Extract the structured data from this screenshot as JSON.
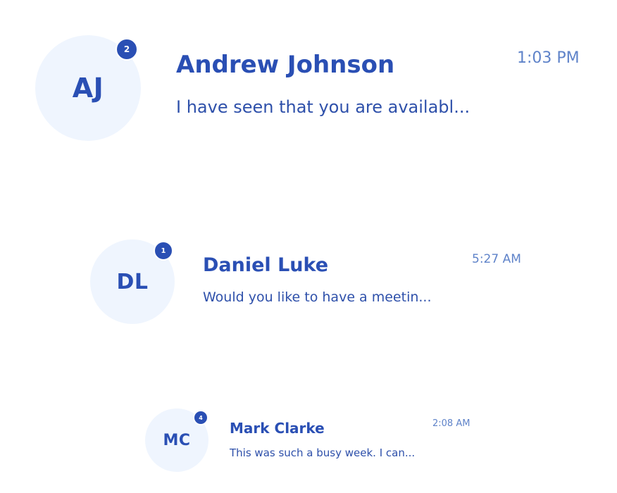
{
  "colors": {
    "accent": "#2a4fb4",
    "avatar_bg": "#eff5fe",
    "timestamp": "#5f83c9",
    "background": "#ffffff"
  },
  "conversations": [
    {
      "initials": "AJ",
      "unread_count": "2",
      "name": "Andrew Johnson",
      "preview": "I have seen that you are availabl...",
      "time": "1:03 PM"
    },
    {
      "initials": "DL",
      "unread_count": "1",
      "name": "Daniel Luke",
      "preview": "Would you like to have a meetin...",
      "time": "5:27 AM"
    },
    {
      "initials": "MC",
      "unread_count": "4",
      "name": "Mark Clarke",
      "preview": "This was such a busy week. I can...",
      "time": "2:08 AM"
    }
  ]
}
